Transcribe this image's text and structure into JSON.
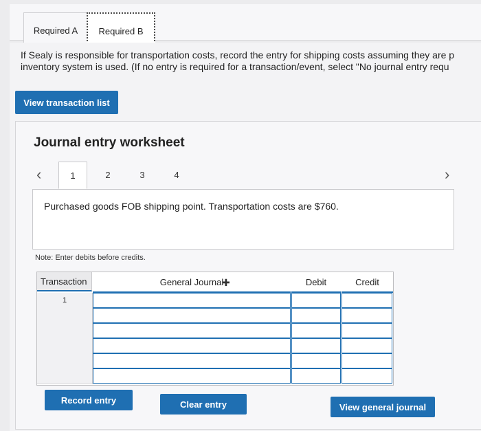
{
  "tabs": [
    {
      "label": "Required A"
    },
    {
      "label": "Required B"
    }
  ],
  "instruction": "If Sealy is responsible for transportation costs, record the entry for shipping costs assuming they are p... inventory system is used. (If no entry is required for a transaction/event, select \"No journal entry requ...",
  "instruction_line1": "If Sealy is responsible for transportation costs, record the entry for shipping costs assuming they are p",
  "instruction_line2": "inventory system is used. (If no entry is required for a transaction/event, select \"No journal entry requ",
  "buttons": {
    "view_transaction_list": "View transaction list",
    "record_entry": "Record entry",
    "clear_entry": "Clear entry",
    "view_general_journal": "View general journal"
  },
  "worksheet": {
    "title": "Journal entry worksheet",
    "pages": [
      "1",
      "2",
      "3",
      "4"
    ],
    "active_page": "1",
    "prev_icon": "chevron-left-icon",
    "next_icon": "chevron-right-icon",
    "description": "Purchased goods FOB shipping point. Transportation costs are $760.",
    "note": "Note: Enter debits before credits."
  },
  "table": {
    "headers": [
      "Transaction",
      "General Journal",
      "Debit",
      "Credit"
    ],
    "rows": [
      {
        "transaction": "1"
      },
      {
        "transaction": ""
      },
      {
        "transaction": ""
      },
      {
        "transaction": ""
      },
      {
        "transaction": ""
      },
      {
        "transaction": ""
      }
    ]
  },
  "colors": {
    "accent": "#1f6fb2"
  }
}
